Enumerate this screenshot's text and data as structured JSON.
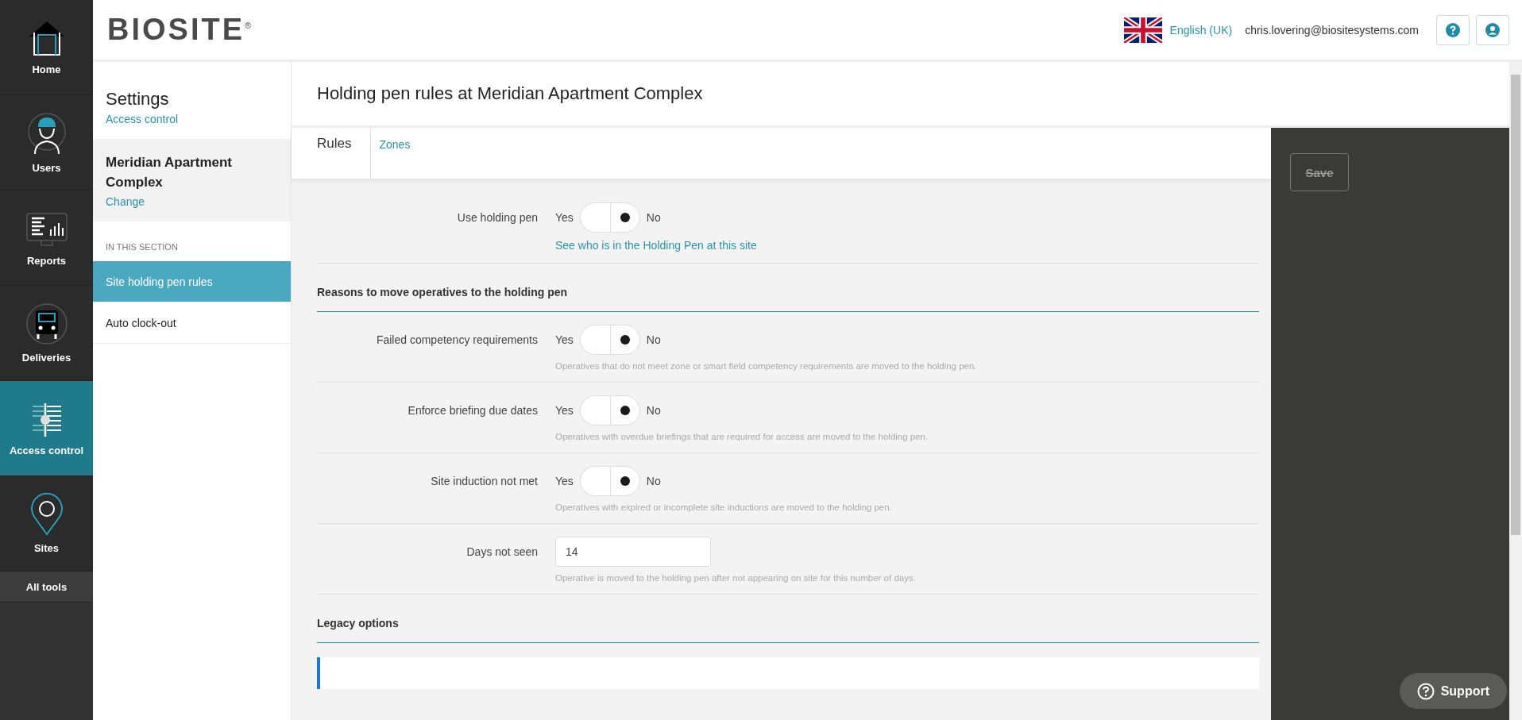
{
  "nav": {
    "items": [
      {
        "label": "Home",
        "kind": "home",
        "selected": false
      },
      {
        "label": "Users",
        "kind": "users",
        "selected": false
      },
      {
        "label": "Reports",
        "kind": "reports",
        "selected": false
      },
      {
        "label": "Deliveries",
        "kind": "deliveries",
        "selected": false
      },
      {
        "label": "Access control",
        "kind": "access",
        "selected": true
      },
      {
        "label": "Sites",
        "kind": "sites",
        "selected": false
      }
    ],
    "all_tools": "All tools"
  },
  "header": {
    "logo": "BIOSITE",
    "logo_mark": "®",
    "language": "English (UK)",
    "email": "chris.lovering@biositesystems.com"
  },
  "settings_sidebar": {
    "title": "Settings",
    "subtitle_link": "Access control",
    "site_name": "Meridian Apartment Complex",
    "change_link": "Change",
    "section_heading": "IN THIS SECTION",
    "items": [
      {
        "label": "Site holding pen rules",
        "selected": true
      },
      {
        "label": "Auto clock-out",
        "selected": false
      }
    ]
  },
  "page": {
    "title": "Holding pen rules at Meridian Apartment Complex",
    "tabs": [
      {
        "label": "Rules",
        "selected": true
      },
      {
        "label": "Zones",
        "selected": false
      }
    ]
  },
  "settings": [
    {
      "kind": "toggle",
      "label": "Use holding pen",
      "options": [
        {
          "label": "Yes",
          "selected": false
        },
        {
          "label": "No",
          "selected": true
        }
      ],
      "link": "See who is in the Holding Pen at this site"
    },
    {
      "kind": "heading",
      "label": "Reasons to move operatives to the holding pen"
    },
    {
      "kind": "toggle",
      "label": "Failed competency requirements",
      "options": [
        {
          "label": "Yes",
          "selected": false
        },
        {
          "label": "No",
          "selected": true
        }
      ],
      "help": "Operatives that do not meet zone or smart field competency requirements are moved to the holding pen."
    },
    {
      "kind": "toggle",
      "label": "Enforce briefing due dates",
      "options": [
        {
          "label": "Yes",
          "selected": false
        },
        {
          "label": "No",
          "selected": true
        }
      ],
      "help": "Operatives with overdue briefings that are required for access are moved to the holding pen."
    },
    {
      "kind": "toggle",
      "label": "Site induction not met",
      "options": [
        {
          "label": "Yes",
          "selected": false
        },
        {
          "label": "No",
          "selected": true
        }
      ],
      "help": "Operatives with expired or incomplete site inductions are moved to the holding pen."
    },
    {
      "kind": "number",
      "label": "Days not seen",
      "value": "14",
      "help": "Operative is moved to the holding pen after not appearing on site for this number of days."
    },
    {
      "kind": "heading",
      "label": "Legacy options"
    }
  ],
  "actions": {
    "save": {
      "label": "Save",
      "disabled": true
    }
  },
  "support": "Support"
}
